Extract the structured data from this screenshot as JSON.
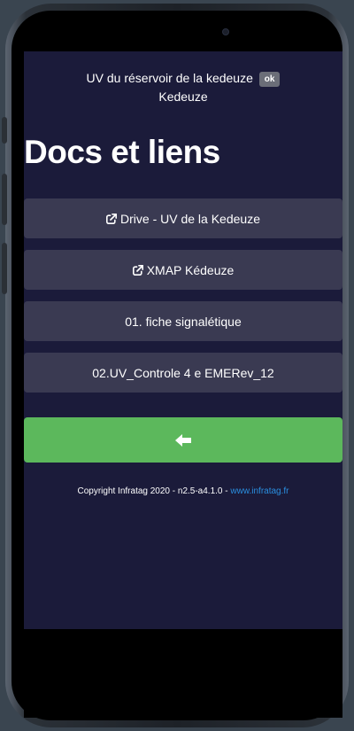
{
  "header": {
    "line1": "UV du réservoir de la kedeuze",
    "ok_label": "ok",
    "line2": "Kedeuze"
  },
  "page_title": "Docs et liens",
  "links": [
    {
      "label": "Drive - UV de la Kedeuze",
      "icon": "external-link-icon"
    },
    {
      "label": "XMAP Kédeuze",
      "icon": "external-link-icon"
    },
    {
      "label": "01. fiche signalétique"
    },
    {
      "label": "02.UV_Controle 4 e EMERev_12"
    }
  ],
  "back_button": {
    "icon": "arrow-left-icon"
  },
  "footer": {
    "text": "Copyright Infratag 2020 - n2.5-a4.1.0 - ",
    "link": "www.infratag.fr"
  },
  "colors": {
    "background": "#1b1b3a",
    "button": "#3a3a52",
    "back_button": "#5cb85c",
    "link": "#2a8fe0"
  }
}
